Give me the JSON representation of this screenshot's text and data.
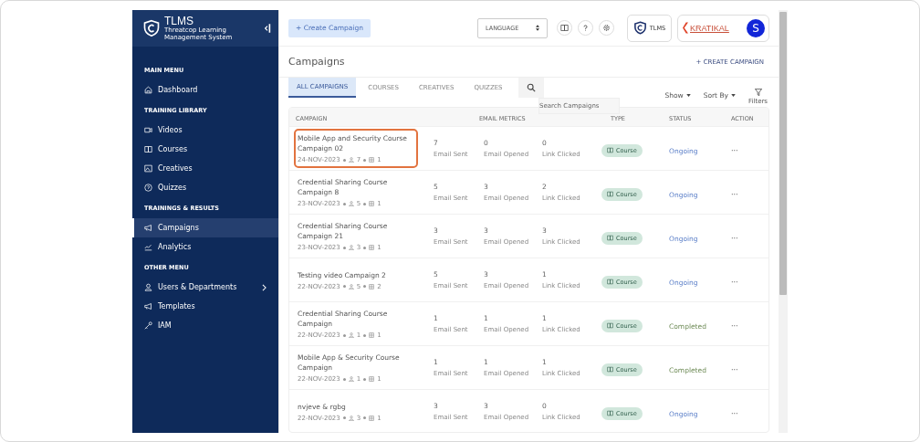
{
  "sidebar": {
    "brand": "TLMS",
    "tagline": "Threatcop Learning Management System",
    "sections": [
      {
        "title": "MAIN MENU",
        "items": [
          {
            "label": "Dashboard",
            "selected": false,
            "has_submenu": false
          }
        ]
      },
      {
        "title": "TRAINING LIBRARY",
        "items": [
          {
            "label": "Videos",
            "selected": false,
            "has_submenu": false
          },
          {
            "label": "Courses",
            "selected": false,
            "has_submenu": false
          },
          {
            "label": "Creatives",
            "selected": false,
            "has_submenu": false
          },
          {
            "label": "Quizzes",
            "selected": false,
            "has_submenu": false
          }
        ]
      },
      {
        "title": "TRAININGS & RESULTS",
        "items": [
          {
            "label": "Campaigns",
            "selected": true,
            "has_submenu": false
          },
          {
            "label": "Analytics",
            "selected": false,
            "has_submenu": false
          }
        ]
      },
      {
        "title": "OTHER MENU",
        "items": [
          {
            "label": "Users & Departments",
            "selected": false,
            "has_submenu": true
          },
          {
            "label": "Templates",
            "selected": false,
            "has_submenu": false
          },
          {
            "label": "IAM",
            "selected": false,
            "has_submenu": false
          }
        ]
      }
    ]
  },
  "topbar": {
    "create_button": "+ Create Campaign",
    "language": "LANGUAGE",
    "product_badge": "TLMS",
    "company_logo": "KRATIKAL",
    "avatar": "S"
  },
  "page": {
    "title": "Campaigns",
    "create_link": "+ CREATE CAMPAIGN",
    "tabs": [
      {
        "label": "ALL CAMPAIGNS",
        "selected": true
      },
      {
        "label": "COURSES",
        "selected": false
      },
      {
        "label": "CREATIVES",
        "selected": false
      },
      {
        "label": "QUIZZES",
        "selected": false
      }
    ],
    "search": {
      "placeholder": "Search Campaigns"
    },
    "show": "Show",
    "sort_by": "Sort By",
    "filters": "Filters"
  },
  "table": {
    "columns": [
      "CAMPAIGN",
      "EMAIL METRICS",
      "TYPE",
      "STATUS",
      "ACTION"
    ],
    "rows": [
      {
        "title": "Mobile App and Security Course Campaign 02",
        "date": "24-NOV-2023",
        "users": "7",
        "items": "1",
        "highlighted": true,
        "sent": "7",
        "opened": "0",
        "clicked": "0",
        "sent_label": "Email Sent",
        "opened_label": "Email Opened",
        "clicked_label": "Link Clicked",
        "type": "Course",
        "status": "Ongoing",
        "completed": false,
        "action": "···"
      },
      {
        "title": "Credential Sharing Course Campaign 8",
        "date": "23-NOV-2023",
        "users": "5",
        "items": "1",
        "highlighted": false,
        "sent": "5",
        "opened": "3",
        "clicked": "2",
        "sent_label": "Email Sent",
        "opened_label": "Email Opened",
        "clicked_label": "Link Clicked",
        "type": "Course",
        "status": "Ongoing",
        "completed": false,
        "action": "···"
      },
      {
        "title": "Credential Sharing Course Campaign 21",
        "date": "23-NOV-2023",
        "users": "3",
        "items": "1",
        "highlighted": false,
        "sent": "3",
        "opened": "3",
        "clicked": "3",
        "sent_label": "Email Sent",
        "opened_label": "Email Opened",
        "clicked_label": "Link Clicked",
        "type": "Course",
        "status": "Ongoing",
        "completed": false,
        "action": "···"
      },
      {
        "title": "Testing video Campaign 2",
        "date": "22-NOV-2023",
        "users": "5",
        "items": "2",
        "highlighted": false,
        "sent": "5",
        "opened": "3",
        "clicked": "1",
        "sent_label": "Email Sent",
        "opened_label": "Email Opened",
        "clicked_label": "Link Clicked",
        "type": "Course",
        "status": "Ongoing",
        "completed": false,
        "action": "···"
      },
      {
        "title": "Credential Sharing Course Campaign",
        "date": "22-NOV-2023",
        "users": "1",
        "items": "1",
        "highlighted": false,
        "sent": "1",
        "opened": "1",
        "clicked": "1",
        "sent_label": "Email Sent",
        "opened_label": "Email Opened",
        "clicked_label": "Link Clicked",
        "type": "Course",
        "status": "Completed",
        "completed": true,
        "action": "···"
      },
      {
        "title": "Mobile App & Security Course Campaign",
        "date": "22-NOV-2023",
        "users": "1",
        "items": "1",
        "highlighted": false,
        "sent": "1",
        "opened": "1",
        "clicked": "1",
        "sent_label": "Email Sent",
        "opened_label": "Email Opened",
        "clicked_label": "Link Clicked",
        "type": "Course",
        "status": "Completed",
        "completed": true,
        "action": "···"
      },
      {
        "title": "nvjeve & rgbg",
        "date": "22-NOV-2023",
        "users": "3",
        "items": "1",
        "highlighted": false,
        "sent": "3",
        "opened": "3",
        "clicked": "0",
        "sent_label": "Email Sent",
        "opened_label": "Email Opened",
        "clicked_label": "Link Clicked",
        "type": "Course",
        "status": "Ongoing",
        "completed": false,
        "action": "···"
      }
    ]
  }
}
